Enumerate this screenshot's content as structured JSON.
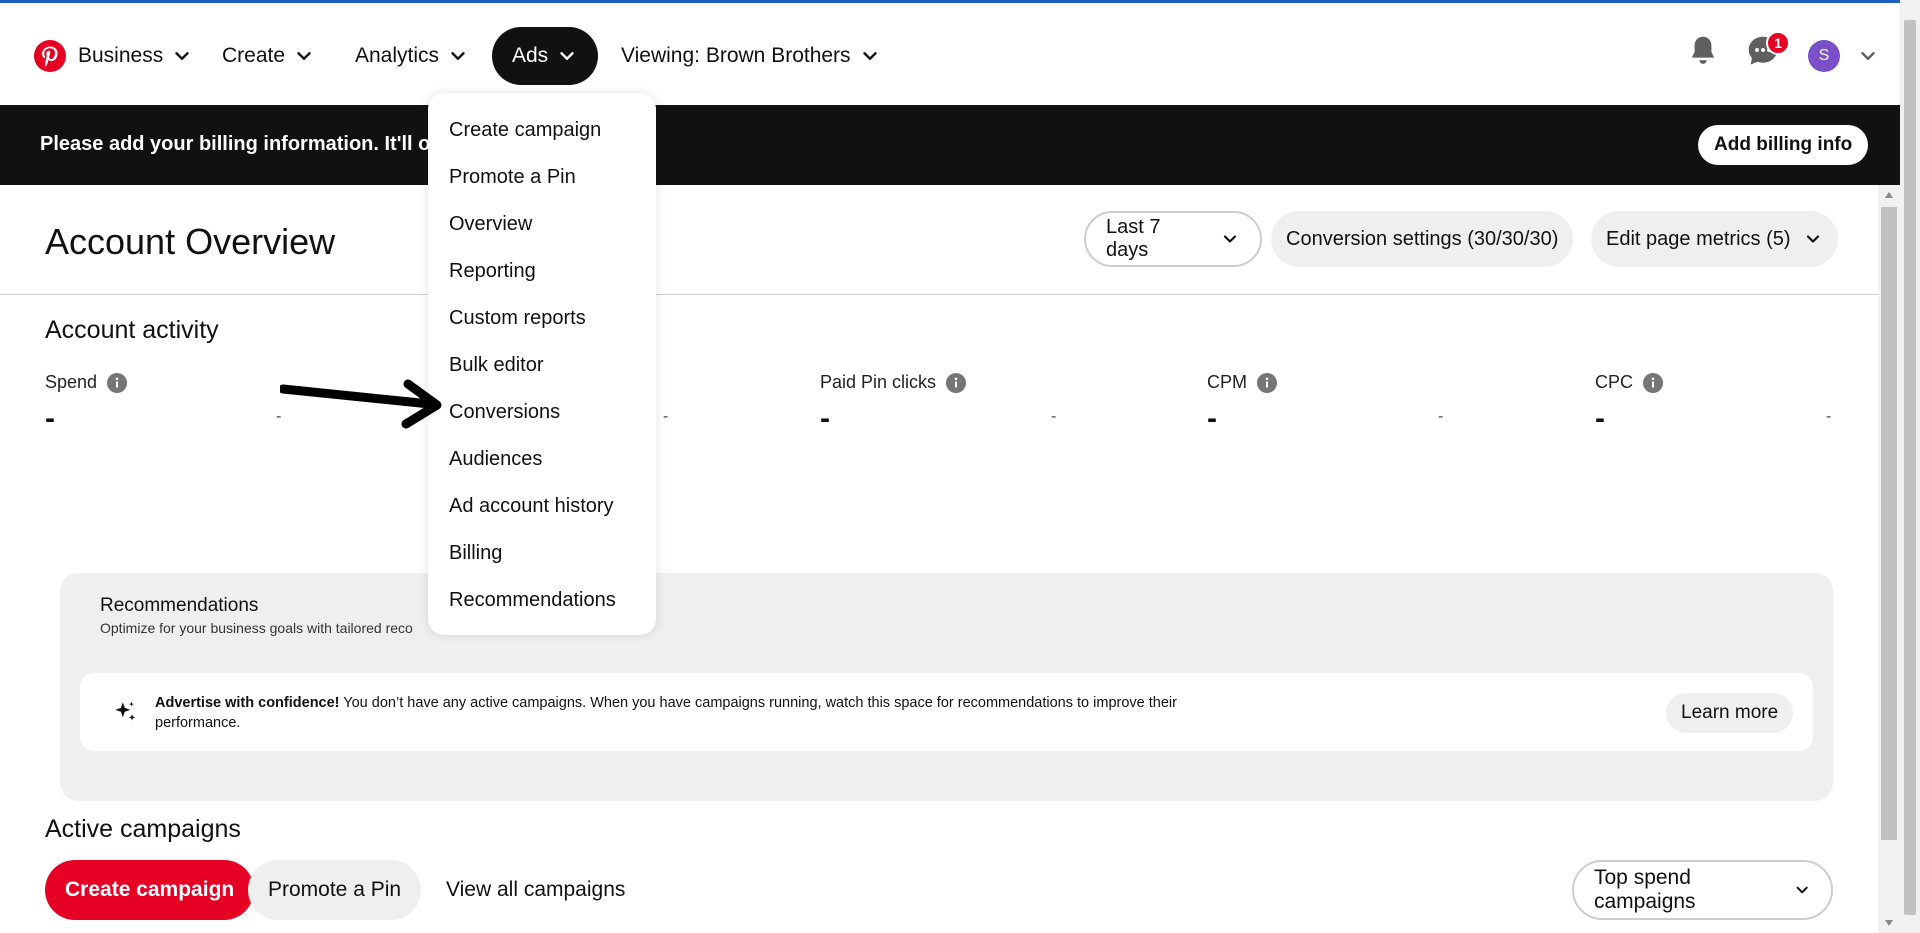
{
  "header": {
    "business_label": "Business",
    "create_label": "Create",
    "analytics_label": "Analytics",
    "ads_label": "Ads",
    "viewing_label": "Viewing: Brown Brothers",
    "messages_badge": "1",
    "avatar_initial": "S"
  },
  "banner": {
    "text": "Please add your billing information. It'll on",
    "button_label": "Add billing info"
  },
  "page": {
    "title": "Account Overview",
    "date_range": "Last 7 days",
    "conversion_settings": "Conversion settings (30/30/30)",
    "edit_metrics": "Edit page metrics (5)"
  },
  "account_activity": {
    "title": "Account activity",
    "metrics": [
      {
        "label": "Spend",
        "value": "-",
        "change": "-"
      },
      {
        "label": "",
        "value": "",
        "change": "-"
      },
      {
        "label": "Paid Pin clicks",
        "value": "-",
        "change": "-"
      },
      {
        "label": "CPM",
        "value": "-",
        "change": "-"
      },
      {
        "label": "CPC",
        "value": "-",
        "change": "-"
      }
    ]
  },
  "recommendations": {
    "title": "Recommendations",
    "subtitle": "Optimize for your business goals with tailored reco",
    "card_bold": "Advertise with confidence!",
    "card_text": " You don’t have any active campaigns. When you have campaigns running, watch this space for recommendations to improve their performance.",
    "learn_more": "Learn more"
  },
  "active_campaigns": {
    "title": "Active campaigns",
    "create_campaign": "Create campaign",
    "promote_pin": "Promote a Pin",
    "view_all": "View all campaigns",
    "sort_select": "Top spend campaigns"
  },
  "ads_menu": {
    "items": [
      "Create campaign",
      "Promote a Pin",
      "Overview",
      "Reporting",
      "Custom reports",
      "Bulk editor",
      "Conversions",
      "Audiences",
      "Ad account history",
      "Billing",
      "Recommendations"
    ]
  },
  "colors": {
    "brand_red": "#e60023",
    "banner_bg": "#111111",
    "panel_gray": "#efefef",
    "avatar_purple": "#7a4fc8"
  },
  "icons": [
    "pinterest-logo",
    "chevron-down-icon",
    "bell-icon",
    "chat-icon",
    "info-icon",
    "sparkle-icon",
    "arrow-annotation"
  ]
}
